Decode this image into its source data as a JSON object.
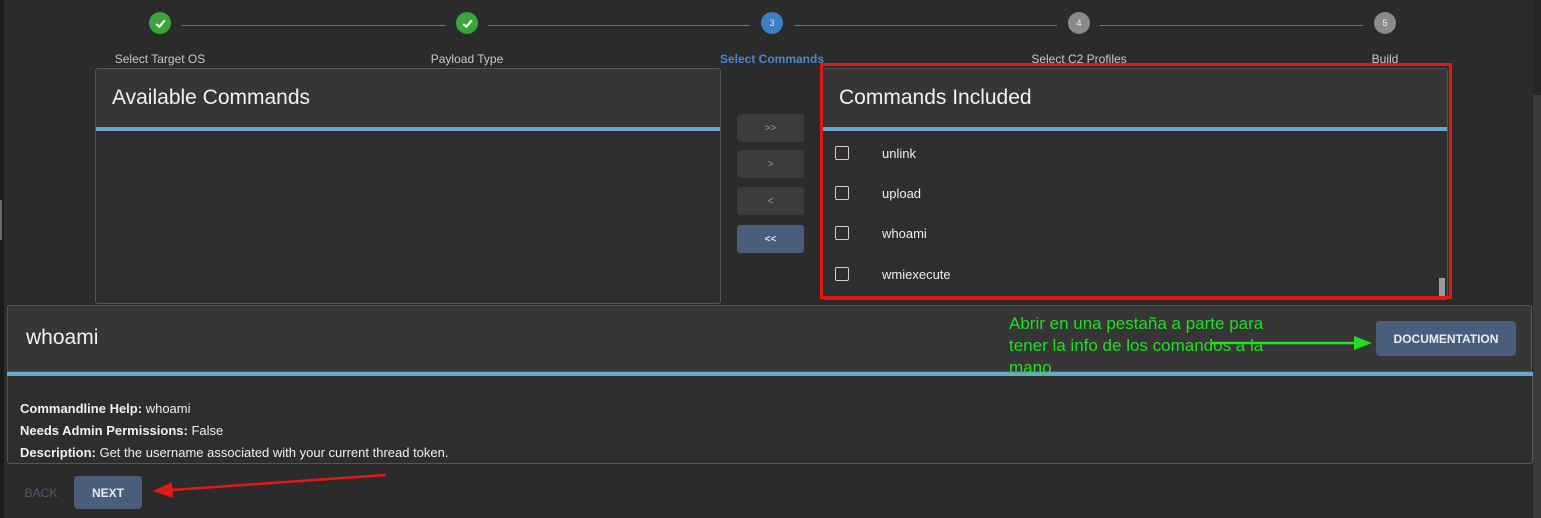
{
  "stepper": {
    "steps": [
      {
        "label": "Select Target OS",
        "number": "1",
        "state": "done"
      },
      {
        "label": "Payload Type",
        "number": "2",
        "state": "done"
      },
      {
        "label": "Select Commands",
        "number": "3",
        "state": "active"
      },
      {
        "label": "Select C2 Profiles",
        "number": "4",
        "state": "todo"
      },
      {
        "label": "Build",
        "number": "5",
        "state": "todo"
      }
    ]
  },
  "available": {
    "title": "Available Commands"
  },
  "transfer": {
    "add_all": ">>",
    "add": ">",
    "remove": "<",
    "remove_all": "<<"
  },
  "included": {
    "title": "Commands Included",
    "items": [
      "unlink",
      "upload",
      "whoami",
      "wmiexecute"
    ]
  },
  "detail": {
    "title": "whoami",
    "documentation_label": "DOCUMENTATION",
    "help_label": "Commandline Help:",
    "help_value": "whoami",
    "admin_label": "Needs Admin Permissions:",
    "admin_value": "False",
    "desc_label": "Description:",
    "desc_value": "Get the username associated with your current thread token."
  },
  "annotation": {
    "text": "Abrir en una pestaña a parte para tener la info de los comandos a la mano",
    "color": "#22dd22",
    "highlight_color": "#e01818"
  },
  "footer": {
    "back_label": "BACK",
    "next_label": "NEXT"
  }
}
